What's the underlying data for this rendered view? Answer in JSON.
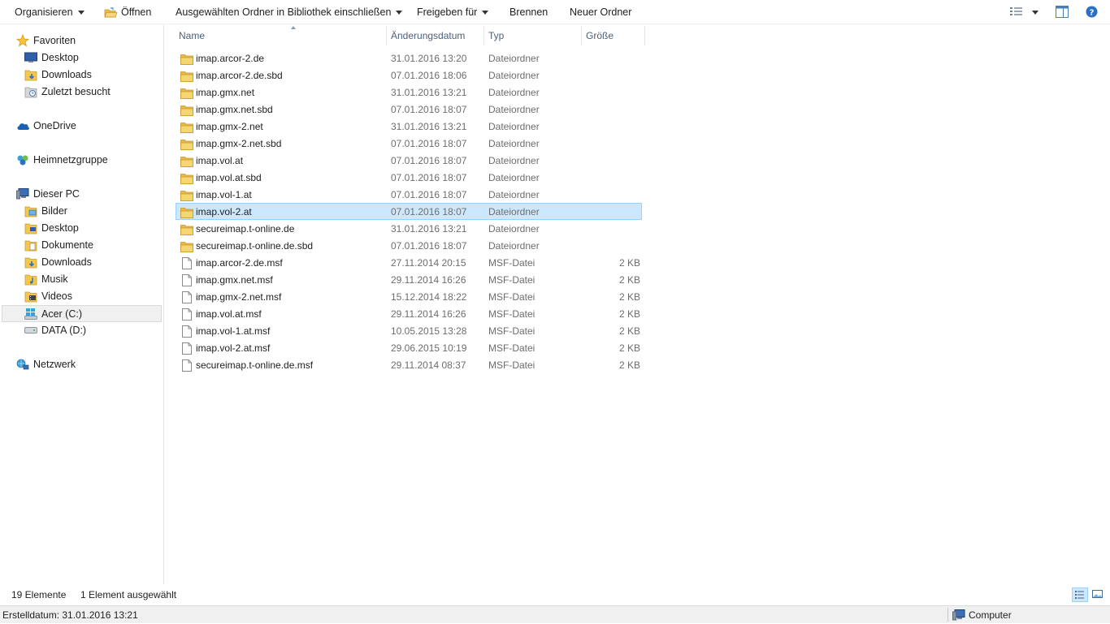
{
  "toolbar": {
    "organize": "Organisieren",
    "open": "Öffnen",
    "include_library": "Ausgewählten Ordner in Bibliothek einschließen",
    "share": "Freigeben für",
    "burn": "Brennen",
    "new_folder": "Neuer Ordner"
  },
  "nav": {
    "favorites": "Favoriten",
    "desktop_fav": "Desktop",
    "downloads_fav": "Downloads",
    "recent": "Zuletzt besucht",
    "onedrive": "OneDrive",
    "homegroup": "Heimnetzgruppe",
    "this_pc": "Dieser PC",
    "pictures": "Bilder",
    "desktop_pc": "Desktop",
    "documents": "Dokumente",
    "downloads_pc": "Downloads",
    "music": "Musik",
    "videos": "Videos",
    "drive_c": "Acer (C:)",
    "drive_d": "DATA (D:)",
    "network": "Netzwerk"
  },
  "columns": {
    "name": "Name",
    "date": "Änderungsdatum",
    "type": "Typ",
    "size": "Größe"
  },
  "files": [
    {
      "name": "imap.arcor-2.de",
      "date": "31.01.2016 13:20",
      "type": "Dateiordner",
      "size": "",
      "kind": "folder"
    },
    {
      "name": "imap.arcor-2.de.sbd",
      "date": "07.01.2016 18:06",
      "type": "Dateiordner",
      "size": "",
      "kind": "folder"
    },
    {
      "name": "imap.gmx.net",
      "date": "31.01.2016 13:21",
      "type": "Dateiordner",
      "size": "",
      "kind": "folder"
    },
    {
      "name": "imap.gmx.net.sbd",
      "date": "07.01.2016 18:07",
      "type": "Dateiordner",
      "size": "",
      "kind": "folder"
    },
    {
      "name": "imap.gmx-2.net",
      "date": "31.01.2016 13:21",
      "type": "Dateiordner",
      "size": "",
      "kind": "folder"
    },
    {
      "name": "imap.gmx-2.net.sbd",
      "date": "07.01.2016 18:07",
      "type": "Dateiordner",
      "size": "",
      "kind": "folder"
    },
    {
      "name": "imap.vol.at",
      "date": "07.01.2016 18:07",
      "type": "Dateiordner",
      "size": "",
      "kind": "folder"
    },
    {
      "name": "imap.vol.at.sbd",
      "date": "07.01.2016 18:07",
      "type": "Dateiordner",
      "size": "",
      "kind": "folder"
    },
    {
      "name": "imap.vol-1.at",
      "date": "07.01.2016 18:07",
      "type": "Dateiordner",
      "size": "",
      "kind": "folder"
    },
    {
      "name": "imap.vol-2.at",
      "date": "07.01.2016 18:07",
      "type": "Dateiordner",
      "size": "",
      "kind": "folder"
    },
    {
      "name": "secureimap.t-online.de",
      "date": "31.01.2016 13:21",
      "type": "Dateiordner",
      "size": "",
      "kind": "folder"
    },
    {
      "name": "secureimap.t-online.de.sbd",
      "date": "07.01.2016 18:07",
      "type": "Dateiordner",
      "size": "",
      "kind": "folder"
    },
    {
      "name": "imap.arcor-2.de.msf",
      "date": "27.11.2014 20:15",
      "type": "MSF-Datei",
      "size": "2 KB",
      "kind": "file"
    },
    {
      "name": "imap.gmx.net.msf",
      "date": "29.11.2014 16:26",
      "type": "MSF-Datei",
      "size": "2 KB",
      "kind": "file"
    },
    {
      "name": "imap.gmx-2.net.msf",
      "date": "15.12.2014 18:22",
      "type": "MSF-Datei",
      "size": "2 KB",
      "kind": "file"
    },
    {
      "name": "imap.vol.at.msf",
      "date": "29.11.2014 16:26",
      "type": "MSF-Datei",
      "size": "2 KB",
      "kind": "file"
    },
    {
      "name": "imap.vol-1.at.msf",
      "date": "10.05.2015 13:28",
      "type": "MSF-Datei",
      "size": "2 KB",
      "kind": "file"
    },
    {
      "name": "imap.vol-2.at.msf",
      "date": "29.06.2015 10:19",
      "type": "MSF-Datei",
      "size": "2 KB",
      "kind": "file"
    },
    {
      "name": "secureimap.t-online.de.msf",
      "date": "29.11.2014 08:37",
      "type": "MSF-Datei",
      "size": "2 KB",
      "kind": "file"
    }
  ],
  "selected_file": "imap.vol-2.at",
  "status": {
    "count": "19 Elemente",
    "selection": "1 Element ausgewählt"
  },
  "bottom": {
    "created": "Erstelldatum: 31.01.2016 13:21",
    "computer": "Computer"
  },
  "colors": {
    "selection_bg": "#cce8ff",
    "selection_border": "#99d1ff",
    "folder_yellow": "#f2c94c",
    "header_text": "#4c607a"
  }
}
